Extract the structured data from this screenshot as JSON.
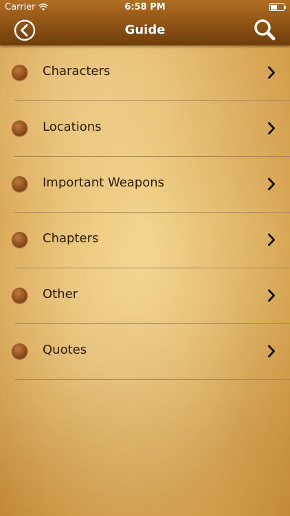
{
  "status_bar": {
    "carrier": "Carrier",
    "time": "6:58 PM",
    "battery_level": 0.5
  },
  "nav": {
    "title": "Guide",
    "back_icon": "circle-chevron-left-icon",
    "search_icon": "search-icon"
  },
  "colors": {
    "nav_bar": "#8d5215",
    "bullet": "#8e4d1d",
    "text": "#2a1a08",
    "divider": "#a9875c"
  },
  "menu": {
    "items": [
      {
        "label": "Characters"
      },
      {
        "label": "Locations"
      },
      {
        "label": "Important Weapons"
      },
      {
        "label": "Chapters"
      },
      {
        "label": "Other"
      },
      {
        "label": "Quotes"
      }
    ]
  }
}
